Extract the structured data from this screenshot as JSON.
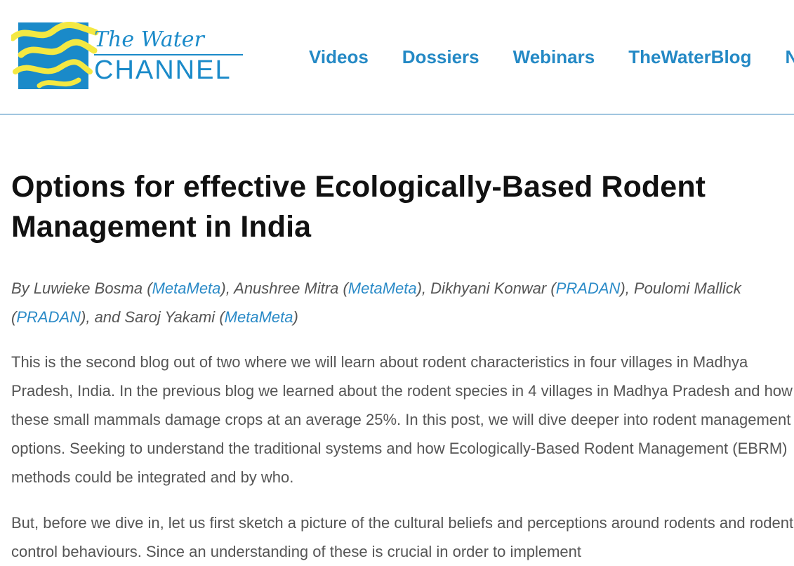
{
  "logo": {
    "line1": "The Water",
    "line2": "CHANNEL",
    "colors": {
      "blue": "#1a8ac9",
      "yellow": "#f4e842"
    }
  },
  "nav": [
    "Videos",
    "Dossiers",
    "Webinars",
    "TheWaterBlog",
    "Ne"
  ],
  "article": {
    "title": "Options for effective Ecologically-Based Rodent Management in India",
    "byline": {
      "prefix": "By",
      "authors": [
        {
          "name": "Luwieke Bosma",
          "org": "MetaMeta"
        },
        {
          "name": "Anushree Mitra",
          "org": "MetaMeta"
        },
        {
          "name": "Dikhyani Konwar",
          "org": "PRADAN"
        },
        {
          "name": "Poulomi Mallick",
          "org": "PRADAN"
        },
        {
          "name": "Saroj Yakami",
          "org": "MetaMeta"
        }
      ]
    },
    "paragraphs": [
      "This is the second blog out of two where we will learn about rodent characteristics in four villages in Madhya Pradesh, India. In the previous blog we learned about the rodent species in 4 villages in Madhya Pradesh and how these small mammals damage crops at an average 25%. In this post, we will dive deeper into rodent management options. Seeking to understand the traditional systems and how Ecologically-Based Rodent Management (EBRM) methods could be integrated and by who.",
      "But, before we dive in, let us first sketch a picture of the cultural beliefs and perceptions around rodents and rodent control behaviours. Since an understanding of these is crucial in order to implement"
    ]
  },
  "colors": {
    "link": "#2489c5",
    "text": "#555555",
    "heading": "#111111",
    "divider": "#2a7db8"
  }
}
